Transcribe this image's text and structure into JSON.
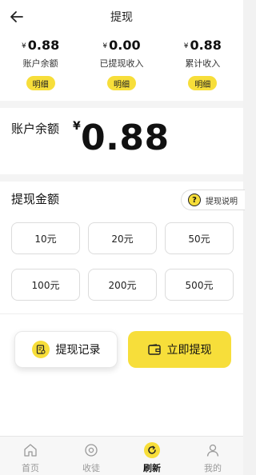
{
  "header": {
    "title": "提现"
  },
  "summary": [
    {
      "currency": "¥",
      "value": "0.88",
      "label": "账户余额",
      "button": "明细"
    },
    {
      "currency": "¥",
      "value": "0.00",
      "label": "已提现收入",
      "button": "明细"
    },
    {
      "currency": "¥",
      "value": "0.88",
      "label": "累计收入",
      "button": "明细"
    }
  ],
  "balance": {
    "label": "账户余额",
    "currency": "¥",
    "amount": "0.88"
  },
  "withdraw": {
    "title": "提现金额",
    "help_label": "提现说明",
    "help_icon_text": "?",
    "options": [
      "10元",
      "20元",
      "50元",
      "100元",
      "200元",
      "500元"
    ]
  },
  "actions": {
    "records_label": "提现记录",
    "submit_label": "立即提现"
  },
  "tabbar": {
    "items": [
      {
        "label": "首页",
        "icon": "home-icon",
        "active": false
      },
      {
        "label": "收徒",
        "icon": "target-icon",
        "active": false
      },
      {
        "label": "刷新",
        "icon": "refresh-icon",
        "active": true
      },
      {
        "label": "我的",
        "icon": "person-icon",
        "active": false
      }
    ]
  },
  "colors": {
    "accent": "#f7de3a",
    "text": "#111111",
    "muted": "#999999"
  }
}
